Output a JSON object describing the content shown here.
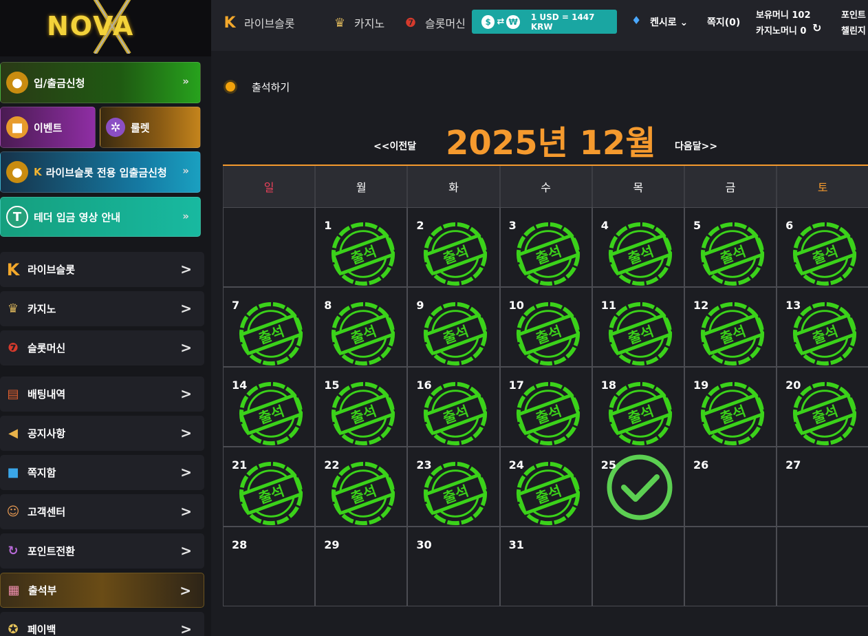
{
  "logo": {
    "text": "NOVA"
  },
  "sidebar": {
    "quick_buttons": {
      "deposit": "입/출금신청",
      "event": "이벤트",
      "roulette": "룰렛",
      "live_deposit": "라이브슬롯 전용 입출금신청",
      "tether": "테더 입금 영상 안내"
    },
    "menu": [
      {
        "label": "라이브슬롯",
        "icon": "live-slot-icon"
      },
      {
        "label": "카지노",
        "icon": "casino-icon"
      },
      {
        "label": "슬롯머신",
        "icon": "slot-machine-icon"
      },
      {
        "label": "배팅내역",
        "icon": "clipboard-icon"
      },
      {
        "label": "공지사항",
        "icon": "megaphone-icon"
      },
      {
        "label": "쪽지함",
        "icon": "chat-bubble-icon"
      },
      {
        "label": "고객센터",
        "icon": "headset-icon"
      },
      {
        "label": "포인트전환",
        "icon": "refresh-icon"
      },
      {
        "label": "출석부",
        "icon": "calendar-icon"
      },
      {
        "label": "페이백",
        "icon": "star-coin-icon"
      }
    ]
  },
  "header": {
    "nav": {
      "live_slot": "라이브슬롯",
      "casino": "카지노",
      "slot_machine": "슬롯머신"
    },
    "rate": {
      "from_symbol": "$",
      "to_symbol": "₩",
      "text": "1 USD = 1447 KRW"
    },
    "user": "켄시로",
    "messages": "쪽지(0)",
    "balance": "보유머니 102",
    "casino_money": "카지노머니 0",
    "points": "포인트",
    "challenge": "챌린지"
  },
  "attendance": {
    "section_title": "출석하기",
    "prev": "<<이전달",
    "next": "다음달>>",
    "month_title": "2025년 12월",
    "weekdays": [
      "일",
      "월",
      "화",
      "수",
      "목",
      "금",
      "토"
    ],
    "stamp_label": "출석",
    "days": [
      {
        "d": "",
        "s": "none"
      },
      {
        "d": "1",
        "s": "stamp"
      },
      {
        "d": "2",
        "s": "stamp"
      },
      {
        "d": "3",
        "s": "stamp"
      },
      {
        "d": "4",
        "s": "stamp"
      },
      {
        "d": "5",
        "s": "stamp"
      },
      {
        "d": "6",
        "s": "stamp"
      },
      {
        "d": "7",
        "s": "stamp"
      },
      {
        "d": "8",
        "s": "stamp"
      },
      {
        "d": "9",
        "s": "stamp"
      },
      {
        "d": "10",
        "s": "stamp"
      },
      {
        "d": "11",
        "s": "stamp"
      },
      {
        "d": "12",
        "s": "stamp"
      },
      {
        "d": "13",
        "s": "stamp"
      },
      {
        "d": "14",
        "s": "stamp"
      },
      {
        "d": "15",
        "s": "stamp"
      },
      {
        "d": "16",
        "s": "stamp"
      },
      {
        "d": "17",
        "s": "stamp"
      },
      {
        "d": "18",
        "s": "stamp"
      },
      {
        "d": "19",
        "s": "stamp"
      },
      {
        "d": "20",
        "s": "stamp"
      },
      {
        "d": "21",
        "s": "stamp"
      },
      {
        "d": "22",
        "s": "stamp"
      },
      {
        "d": "23",
        "s": "stamp"
      },
      {
        "d": "24",
        "s": "stamp"
      },
      {
        "d": "25",
        "s": "check"
      },
      {
        "d": "26",
        "s": "none"
      },
      {
        "d": "27",
        "s": "none"
      },
      {
        "d": "28",
        "s": "none"
      },
      {
        "d": "29",
        "s": "none"
      },
      {
        "d": "30",
        "s": "none"
      },
      {
        "d": "31",
        "s": "none"
      },
      {
        "d": "",
        "s": "none"
      },
      {
        "d": "",
        "s": "none"
      },
      {
        "d": "",
        "s": "none"
      }
    ]
  },
  "colors": {
    "accent": "#f59a2e",
    "stamp_green": "#3bd21a",
    "check_green": "#5ccf52"
  }
}
